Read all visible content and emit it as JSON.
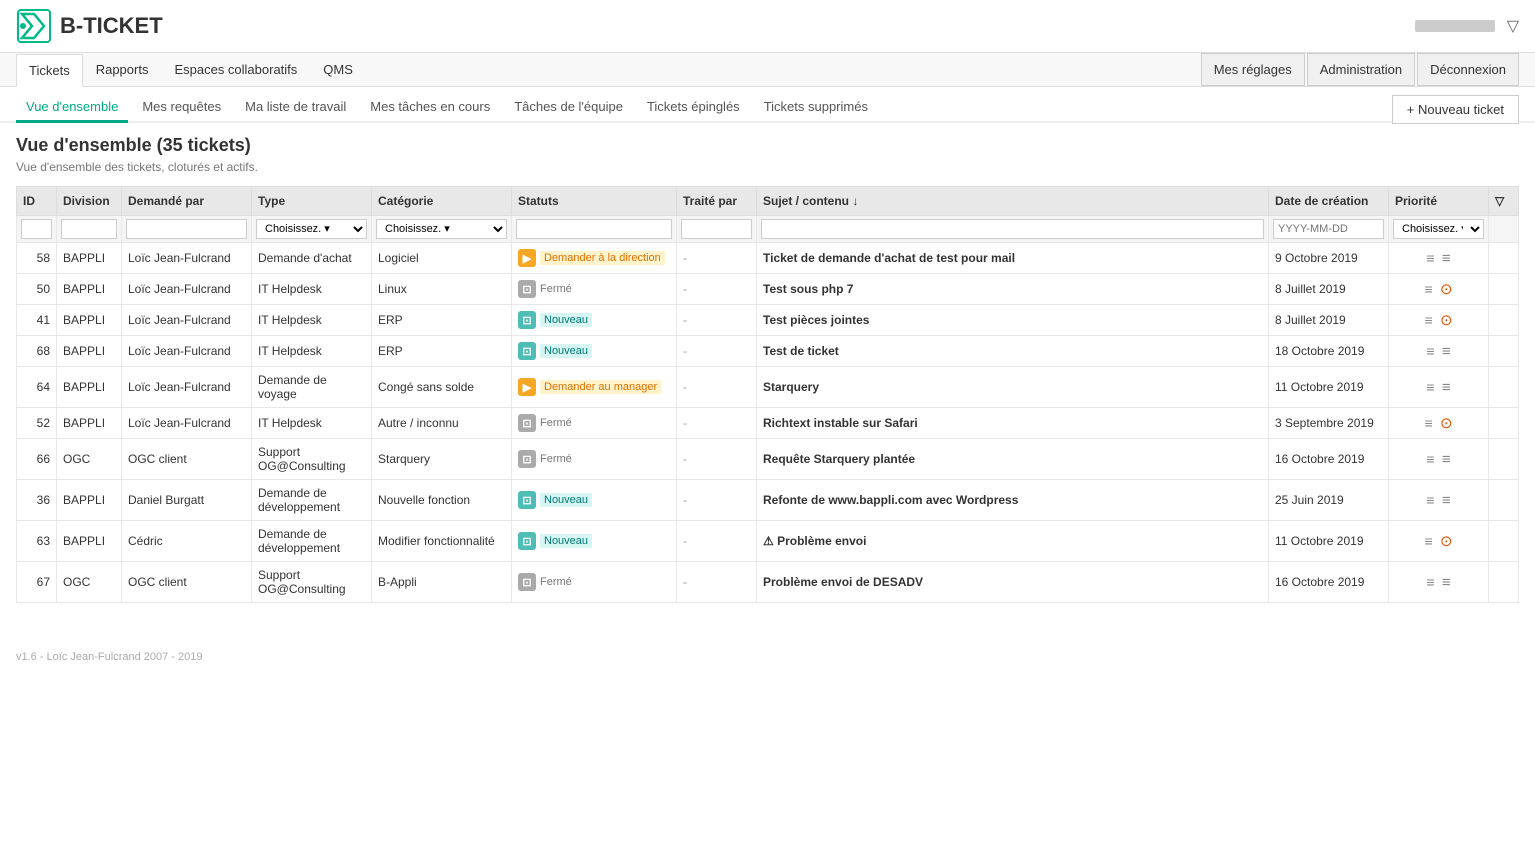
{
  "header": {
    "logo_text": "B-TICKET",
    "user_btn_label": "",
    "filter_label": "▽"
  },
  "top_nav": {
    "items": [
      {
        "label": "Tickets",
        "active": true
      },
      {
        "label": "Rapports",
        "active": false
      },
      {
        "label": "Espaces collaboratifs",
        "active": false
      },
      {
        "label": "QMS",
        "active": false
      }
    ],
    "right_items": [
      {
        "label": "Mes réglages"
      },
      {
        "label": "Administration"
      },
      {
        "label": "Déconnexion"
      }
    ]
  },
  "sub_nav": {
    "items": [
      {
        "label": "Vue d'ensemble",
        "active": true
      },
      {
        "label": "Mes requêtes",
        "active": false
      },
      {
        "label": "Ma liste de travail",
        "active": false
      },
      {
        "label": "Mes tâches en cours",
        "active": false
      },
      {
        "label": "Tâches de l'équipe",
        "active": false
      },
      {
        "label": "Tickets épinglés",
        "active": false
      },
      {
        "label": "Tickets supprimés",
        "active": false
      }
    ]
  },
  "page": {
    "title": "Vue d'ensemble (35 tickets)",
    "subtitle": "Vue d'ensemble des tickets, cloturés et actifs.",
    "new_ticket_label": "+ Nouveau ticket"
  },
  "table": {
    "columns": [
      {
        "label": "ID",
        "key": "id"
      },
      {
        "label": "Division",
        "key": "division"
      },
      {
        "label": "Demandé par",
        "key": "demande_par"
      },
      {
        "label": "Type",
        "key": "type"
      },
      {
        "label": "Catégorie",
        "key": "categorie"
      },
      {
        "label": "Statuts",
        "key": "statuts"
      },
      {
        "label": "Traité par",
        "key": "traite_par"
      },
      {
        "label": "Sujet / contenu ↓",
        "key": "sujet"
      },
      {
        "label": "Date de création",
        "key": "date"
      },
      {
        "label": "Priorité",
        "key": "priorite"
      },
      {
        "label": "",
        "key": "actions"
      }
    ],
    "filters": {
      "type_placeholder": "Choisissez. ▾",
      "categorie_placeholder": "Choisissez. ▾",
      "date_placeholder": "YYYY-MM-DD",
      "priorite_placeholder": "Choisissez. ▾"
    },
    "rows": [
      {
        "id": "58",
        "division": "BAPPLI",
        "demande_par": "Loïc Jean-Fulcrand",
        "type": "Demande d'achat",
        "categorie": "Logiciel",
        "status_type": "orange",
        "status_label": "Demander à la direction",
        "traite_par": "-",
        "sujet": "Ticket de demande d'achat de test pour mail",
        "date": "9 Octobre 2019",
        "priorite": "medium",
        "actions": "≡",
        "priority_icon": "medium"
      },
      {
        "id": "50",
        "division": "BAPPLI",
        "demande_par": "Loïc Jean-Fulcrand",
        "type": "IT Helpdesk",
        "categorie": "Linux",
        "status_type": "gray",
        "status_label": "Fermé",
        "traite_par": "-",
        "sujet": "Test sous php 7",
        "date": "8 Juillet 2019",
        "priorite": "medium",
        "actions": "≡",
        "priority_icon": "high"
      },
      {
        "id": "41",
        "division": "BAPPLI",
        "demande_par": "Loïc Jean-Fulcrand",
        "type": "IT Helpdesk",
        "categorie": "ERP",
        "status_type": "teal",
        "status_label": "Nouveau",
        "traite_par": "-",
        "sujet": "Test pièces jointes",
        "date": "8 Juillet 2019",
        "priorite": "medium",
        "actions": "≡",
        "priority_icon": "high"
      },
      {
        "id": "68",
        "division": "BAPPLI",
        "demande_par": "Loïc Jean-Fulcrand",
        "type": "IT Helpdesk",
        "categorie": "ERP",
        "status_type": "teal",
        "status_label": "Nouveau",
        "traite_par": "-",
        "sujet": "Test de ticket",
        "date": "18 Octobre 2019",
        "priorite": "medium",
        "actions": "≡",
        "priority_icon": "medium"
      },
      {
        "id": "64",
        "division": "BAPPLI",
        "demande_par": "Loïc Jean-Fulcrand",
        "type": "Demande de voyage",
        "categorie": "Congé sans solde",
        "status_type": "orange",
        "status_label": "Demander au manager",
        "traite_par": "-",
        "sujet": "Starquery",
        "date": "11 Octobre 2019",
        "priorite": "medium",
        "actions": "≡",
        "priority_icon": "medium"
      },
      {
        "id": "52",
        "division": "BAPPLI",
        "demande_par": "Loïc Jean-Fulcrand",
        "type": "IT Helpdesk",
        "categorie": "Autre / inconnu",
        "status_type": "gray",
        "status_label": "Fermé",
        "traite_par": "-",
        "sujet": "Richtext instable sur Safari",
        "date": "3 Septembre 2019",
        "priorite": "high",
        "actions": "≡",
        "priority_icon": "high"
      },
      {
        "id": "66",
        "division": "OGC",
        "demande_par": "OGC client",
        "type": "Support OG@Consulting",
        "categorie": "Starquery",
        "status_type": "gray",
        "status_label": "Fermé",
        "traite_par": "-",
        "sujet": "Requête Starquery plantée",
        "date": "16 Octobre 2019",
        "priorite": "medium",
        "actions": "≡",
        "priority_icon": "medium"
      },
      {
        "id": "36",
        "division": "BAPPLI",
        "demande_par": "Daniel Burgatt",
        "type": "Demande de développement",
        "categorie": "Nouvelle fonction",
        "status_type": "teal",
        "status_label": "Nouveau",
        "traite_par": "-",
        "sujet": "Refonte de www.bappli.com avec Wordpress",
        "date": "25 Juin 2019",
        "priorite": "medium",
        "actions": "≡",
        "priority_icon": "medium"
      },
      {
        "id": "63",
        "division": "BAPPLI",
        "demande_par": "Cédric",
        "type": "Demande de développement",
        "categorie": "Modifier fonctionnalité",
        "status_type": "teal",
        "status_label": "Nouveau",
        "traite_par": "-",
        "sujet": "⚠ Problème envoi",
        "date": "11 Octobre 2019",
        "priorite": "high",
        "actions": "≡",
        "priority_icon": "high"
      },
      {
        "id": "67",
        "division": "OGC",
        "demande_par": "OGC client",
        "type": "Support OG@Consulting",
        "categorie": "B-Appli",
        "status_type": "gray",
        "status_label": "Fermé",
        "traite_par": "-",
        "sujet": "Problème envoi de DESADV",
        "date": "16 Octobre 2019",
        "priorite": "medium",
        "actions": "≡",
        "priority_icon": "medium"
      }
    ]
  },
  "footer": {
    "version": "v1.6 - Loïc Jean-Fulcrand 2007 - 2019"
  }
}
